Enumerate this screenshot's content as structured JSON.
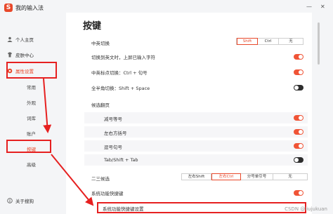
{
  "app": {
    "title": "我的输入法",
    "logo": "S",
    "window_controls": [
      "minimize-icon",
      "close-icon"
    ],
    "min_glyph": "—",
    "close_glyph": "✕"
  },
  "sidebar": {
    "items": [
      {
        "label": "个人主页",
        "icon": "person-icon"
      },
      {
        "label": "皮肤中心",
        "icon": "skin-icon"
      },
      {
        "label": "属性设置",
        "icon": "settings-icon"
      }
    ],
    "sub_items": [
      "常用",
      "外观",
      "词库",
      "账户",
      "按键",
      "高级"
    ],
    "active_sub": "按键",
    "footer": {
      "label": "关于搜狗",
      "icon": "about-icon"
    }
  },
  "page": {
    "title": "按键"
  },
  "settings": {
    "switch_cn_en": {
      "label": "中英切换",
      "options": [
        "Shift",
        "Ctrl",
        "无"
      ],
      "selected": "Shift"
    },
    "commit_on_switch": {
      "label": "切换到英文时，上屏已输入字符",
      "state": "on"
    },
    "punct_switch": {
      "label": "中英标点切换：Ctrl + 句号",
      "state": "on"
    },
    "fullwidth_switch": {
      "label": "全半角切换：Shift + Space",
      "state": "off"
    },
    "candidate_paging": {
      "label": "候选翻页",
      "items": [
        {
          "label": "减号等号",
          "state": "on"
        },
        {
          "label": "左右方括号",
          "state": "on"
        },
        {
          "label": "逗号句号",
          "state": "on"
        },
        {
          "label": "Tab/Shift + Tab",
          "state": "off"
        }
      ]
    },
    "second_third_candidate": {
      "label": "二三候选",
      "options": [
        "左右Shift",
        "左右Ctrl",
        "分号单引号",
        "无"
      ],
      "selected": "左右Ctrl"
    },
    "system_shortcut": {
      "label": "系统功能快捷键",
      "state": "on"
    },
    "system_shortcut_settings": {
      "label": "系统功能快捷键设置"
    }
  },
  "watermark": "CSDN @liujukuan",
  "colors": {
    "accent": "#e8482a",
    "highlight_box": "#e62020",
    "toggle_on": "#f05436",
    "toggle_off": "#2d2d2d"
  }
}
